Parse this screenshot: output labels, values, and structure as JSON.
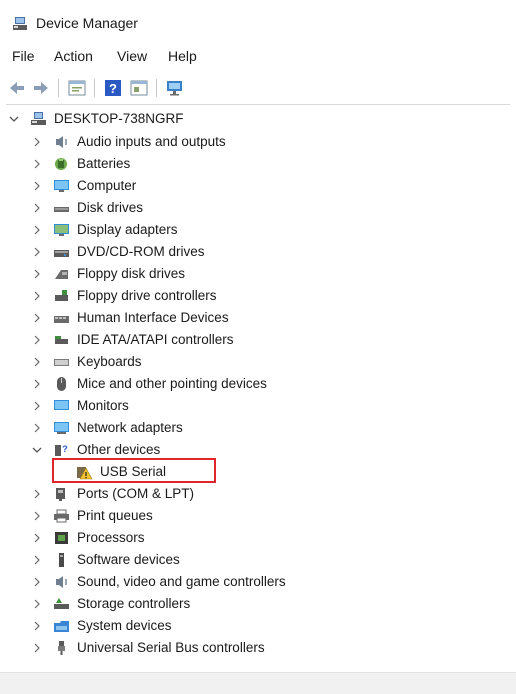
{
  "window": {
    "title": "Device Manager"
  },
  "menu": [
    "File",
    "Action",
    "View",
    "Help"
  ],
  "tree": {
    "root": "DESKTOP-738NGRF",
    "categories": [
      "Audio inputs and outputs",
      "Batteries",
      "Computer",
      "Disk drives",
      "Display adapters",
      "DVD/CD-ROM drives",
      "Floppy disk drives",
      "Floppy drive controllers",
      "Human Interface Devices",
      "IDE ATA/ATAPI controllers",
      "Keyboards",
      "Mice and other pointing devices",
      "Monitors",
      "Network adapters",
      "Other devices",
      "Ports (COM & LPT)",
      "Print queues",
      "Processors",
      "Software devices",
      "Sound, video and game controllers",
      "Storage controllers",
      "System devices",
      "Universal Serial Bus controllers"
    ],
    "other_devices_child": "USB Serial"
  },
  "colors": {
    "highlight": "#e0262b"
  }
}
